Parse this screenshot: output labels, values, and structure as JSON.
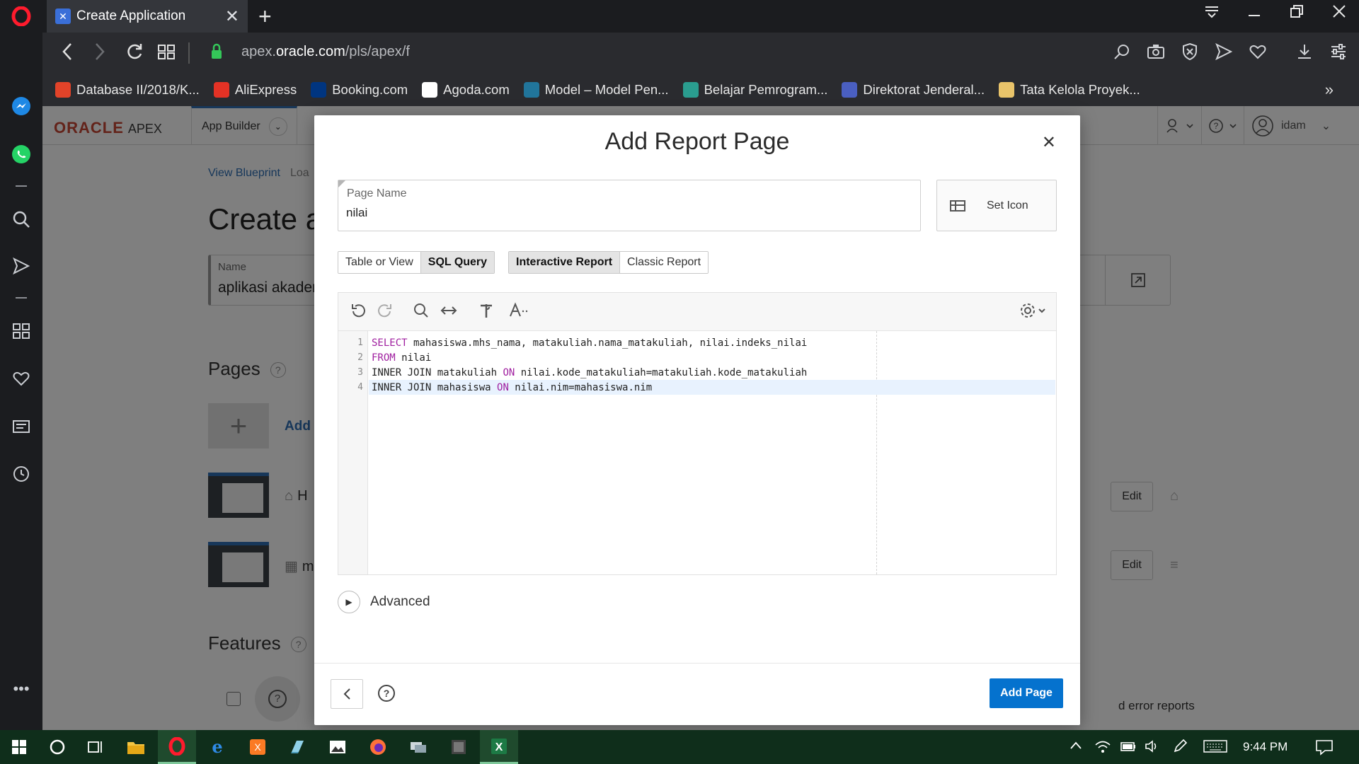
{
  "browser": {
    "tab_title": "Create Application",
    "url_prefix": "apex.",
    "url_domain": "oracle.com",
    "url_path": "/pls/apex/f",
    "bookmarks": [
      {
        "label": "Database II/2018/K...",
        "icon": "gitlab-icon",
        "color": "#e24329"
      },
      {
        "label": "AliExpress",
        "icon": "aliexpress-icon",
        "color": "#e43225"
      },
      {
        "label": "Booking.com",
        "icon": "booking-icon",
        "color": "#003580"
      },
      {
        "label": "Agoda.com",
        "icon": "agoda-icon",
        "color": "#ffffff"
      },
      {
        "label": "Model – Model Pen...",
        "icon": "wordpress-icon",
        "color": "#21759b"
      },
      {
        "label": "Belajar Pemrogram...",
        "icon": "globe-icon",
        "color": "#2a9d8f"
      },
      {
        "label": "Direktorat Jenderal...",
        "icon": "direktorat-icon",
        "color": "#4a5fc1"
      },
      {
        "label": "Tata Kelola Proyek...",
        "icon": "folder-icon",
        "color": "#e9c46a"
      }
    ]
  },
  "apex": {
    "logo_oracle": "ORACLE",
    "logo_apex": "APEX",
    "nav_app_builder": "App Builder",
    "nav_user": "idam",
    "breadcrumb_blueprint": "View Blueprint",
    "breadcrumb_load": "Loa",
    "page_title": "Create a",
    "name_label": "Name",
    "name_value": "aplikasi akader",
    "pages_heading": "Pages",
    "add_label": "Add",
    "page_rows": [
      {
        "name": "H",
        "edit": "Edit"
      },
      {
        "name": "m",
        "edit": "Edit"
      }
    ],
    "features_heading": "Features",
    "error_reports_text": "d error reports"
  },
  "dialog": {
    "title": "Add Report Page",
    "page_name_label": "Page Name",
    "page_name_value": "nilai",
    "set_icon_label": "Set Icon",
    "source_options": [
      "Table or View",
      "SQL Query"
    ],
    "source_selected": "SQL Query",
    "report_type_options": [
      "Interactive Report",
      "Classic Report"
    ],
    "report_type_selected": "Interactive Report",
    "code_lines": [
      [
        "SELECT",
        " mahasiswa.mhs_nama, matakuliah.nama_matakuliah, nilai.indeks_nilai"
      ],
      [
        "FROM",
        " nilai"
      ],
      [
        "INNER JOIN matakuliah ",
        "ON",
        " nilai.kode_matakuliah=matakuliah.kode_matakuliah"
      ],
      [
        "INNER JOIN mahasiswa ",
        "ON",
        " nilai.nim=mahasiswa.nim"
      ]
    ],
    "line_numbers": [
      "1",
      "2",
      "3",
      "4"
    ],
    "advanced_label": "Advanced",
    "add_page_label": "Add Page"
  },
  "taskbar": {
    "clock": "9:44 PM"
  },
  "colors": {
    "primary_button": "#0572ce",
    "oracle_red": "#c74634",
    "sql_keyword": "#a020a0"
  }
}
